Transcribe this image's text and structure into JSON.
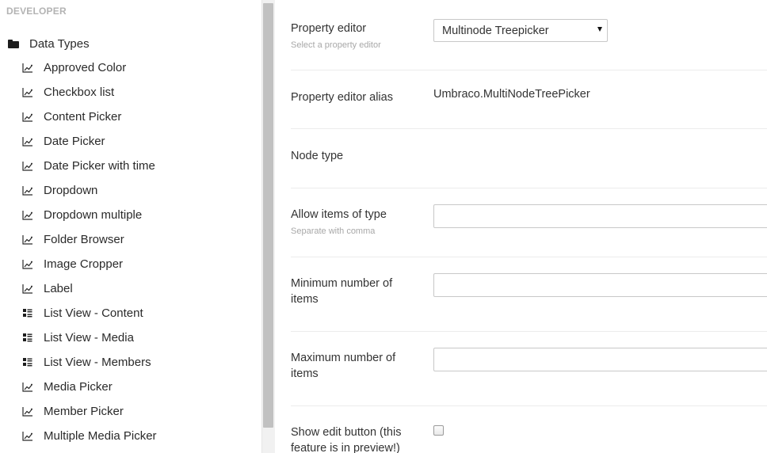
{
  "sidebar": {
    "section_title": "DEVELOPER",
    "root": {
      "label": "Data Types",
      "icon": "folder-icon"
    },
    "items": [
      {
        "label": "Approved Color",
        "icon": "datatype-icon"
      },
      {
        "label": "Checkbox list",
        "icon": "datatype-icon"
      },
      {
        "label": "Content Picker",
        "icon": "datatype-icon"
      },
      {
        "label": "Date Picker",
        "icon": "datatype-icon"
      },
      {
        "label": "Date Picker with time",
        "icon": "datatype-icon"
      },
      {
        "label": "Dropdown",
        "icon": "datatype-icon"
      },
      {
        "label": "Dropdown multiple",
        "icon": "datatype-icon"
      },
      {
        "label": "Folder Browser",
        "icon": "datatype-icon"
      },
      {
        "label": "Image Cropper",
        "icon": "datatype-icon"
      },
      {
        "label": "Label",
        "icon": "datatype-icon"
      },
      {
        "label": "List View - Content",
        "icon": "list-view-icon"
      },
      {
        "label": "List View - Media",
        "icon": "list-view-icon"
      },
      {
        "label": "List View - Members",
        "icon": "list-view-icon"
      },
      {
        "label": "Media Picker",
        "icon": "datatype-icon"
      },
      {
        "label": "Member Picker",
        "icon": "datatype-icon"
      },
      {
        "label": "Multiple Media Picker",
        "icon": "datatype-icon"
      }
    ]
  },
  "main": {
    "property_editor": {
      "label": "Property editor",
      "hint": "Select a property editor",
      "selected": "Multinode Treepicker"
    },
    "property_editor_alias": {
      "label": "Property editor alias",
      "value": "Umbraco.MultiNodeTreePicker"
    },
    "node_type": {
      "label": "Node type"
    },
    "allow_items_of_type": {
      "label": "Allow items of type",
      "hint": "Separate with comma",
      "value": ""
    },
    "minimum_items": {
      "label_line1": "Minimum number of",
      "label_line2": "items",
      "value": ""
    },
    "maximum_items": {
      "label_line1": "Maximum number of",
      "label_line2": "items",
      "value": ""
    },
    "show_edit_button": {
      "label_line1": "Show edit button (this",
      "label_line2": "feature is in preview!)",
      "checked": false
    }
  }
}
